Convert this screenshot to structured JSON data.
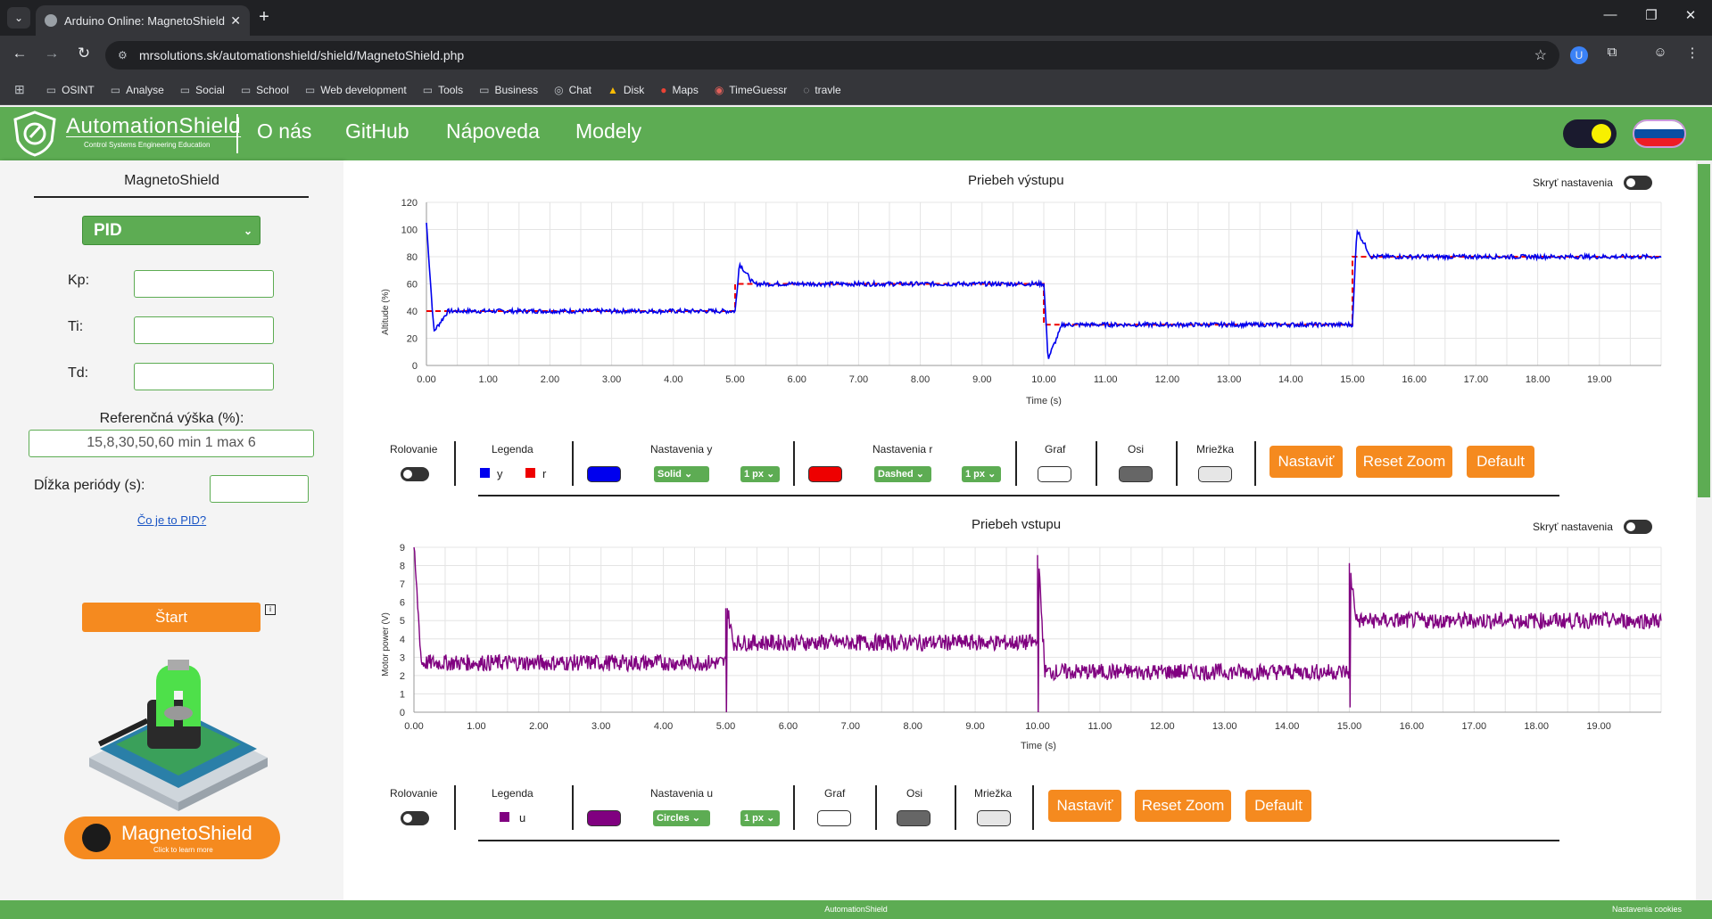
{
  "browser": {
    "tab_title": "Arduino Online: MagnetoShield",
    "url": "mrsolutions.sk/automationshield/shield/MagnetoShield.php",
    "bookmarks": [
      "OSINT",
      "Analyse",
      "Social",
      "School",
      "Web development",
      "Tools",
      "Business",
      "Chat",
      "Disk",
      "Maps",
      "TimeGuessr",
      "travle"
    ]
  },
  "header": {
    "logo_title": "AutomationShield",
    "logo_sub": "Control Systems Engineering Education",
    "nav": [
      "O nás",
      "GitHub",
      "Nápoveda",
      "Modely"
    ]
  },
  "sidebar": {
    "title": "MagnetoShield",
    "mode": "PID",
    "kp_label": "Kp:",
    "ti_label": "Ti:",
    "td_label": "Td:",
    "ref_label": "Referenčná výška (%):",
    "ref_placeholder": "15,8,30,50,60 min 1 max 6",
    "period_label": "Dĺžka periódy (s):",
    "pid_link": "Čo je to PID?",
    "start": "Štart",
    "gh_text": "MagnetoShield",
    "gh_sub": "Click to learn more"
  },
  "chart1": {
    "title": "Priebeh výstupu",
    "hide_label": "Skryť nastavenia",
    "ylabel": "Altitude (%)",
    "xlabel": "Time (s)",
    "controls": {
      "rolovanie": "Rolovanie",
      "legenda": "Legenda",
      "legend_y": "y",
      "legend_r": "r",
      "nast_y": "Nastavenia y",
      "nast_r": "Nastavenia r",
      "y_style": "Solid",
      "y_width": "1 px",
      "r_style": "Dashed",
      "r_width": "1 px",
      "graf": "Graf",
      "osi": "Osi",
      "mriezka": "Mriežka",
      "nastavit": "Nastaviť",
      "reset_zoom": "Reset Zoom",
      "default": "Default"
    }
  },
  "chart2": {
    "title": "Priebeh vstupu",
    "hide_label": "Skryť nastavenia",
    "ylabel": "Motor power (V)",
    "xlabel": "Time (s)",
    "controls": {
      "rolovanie": "Rolovanie",
      "legenda": "Legenda",
      "legend_u": "u",
      "nast_u": "Nastavenia u",
      "u_style": "Circles",
      "u_width": "1 px",
      "graf": "Graf",
      "osi": "Osi",
      "mriezka": "Mriežka",
      "nastavit": "Nastaviť",
      "reset_zoom": "Reset Zoom",
      "default": "Default"
    }
  },
  "footer": {
    "center": "AutomationShield",
    "right": "Nastavenia cookies"
  },
  "colors": {
    "green": "#5dac53",
    "orange": "#f58a1f",
    "y_series": "#0000ee",
    "r_series": "#ee0000",
    "u_series": "#800080"
  },
  "chart_data": [
    {
      "type": "line",
      "title": "Priebeh výstupu",
      "xlabel": "Time (s)",
      "ylabel": "Altitude (%)",
      "xlim": [
        0,
        20
      ],
      "ylim": [
        0,
        120
      ],
      "x_ticks": [
        "0.00",
        "1.00",
        "2.00",
        "3.00",
        "4.00",
        "5.00",
        "6.00",
        "7.00",
        "8.00",
        "9.00",
        "10.00",
        "11.00",
        "12.00",
        "13.00",
        "14.00",
        "15.00",
        "16.00",
        "17.00",
        "18.00",
        "19.00"
      ],
      "y_ticks": [
        0,
        20,
        40,
        60,
        80,
        100,
        120
      ],
      "grid": true,
      "series": [
        {
          "name": "y",
          "color": "#0000ee",
          "style": "solid",
          "segments": [
            {
              "t0": 0,
              "t1": 5,
              "level": 40,
              "start": 105,
              "dip": 25
            },
            {
              "t0": 5,
              "t1": 10,
              "level": 60,
              "overshoot": 75
            },
            {
              "t0": 10,
              "t1": 15,
              "level": 30,
              "undershoot": 5
            },
            {
              "t0": 15,
              "t1": 20,
              "level": 80,
              "overshoot": 100
            }
          ]
        },
        {
          "name": "r",
          "color": "#ee0000",
          "style": "dashed",
          "steps": [
            {
              "t0": 0,
              "t1": 5,
              "v": 40
            },
            {
              "t0": 5,
              "t1": 10,
              "v": 60
            },
            {
              "t0": 10,
              "t1": 15,
              "v": 30
            },
            {
              "t0": 15,
              "t1": 20,
              "v": 80
            }
          ]
        }
      ]
    },
    {
      "type": "line",
      "title": "Priebeh vstupu",
      "xlabel": "Time (s)",
      "ylabel": "Motor power (V)",
      "xlim": [
        0,
        20
      ],
      "ylim": [
        0,
        9
      ],
      "x_ticks": [
        "0.00",
        "1.00",
        "2.00",
        "3.00",
        "4.00",
        "5.00",
        "6.00",
        "7.00",
        "8.00",
        "9.00",
        "10.00",
        "11.00",
        "12.00",
        "13.00",
        "14.00",
        "15.00",
        "16.00",
        "17.00",
        "18.00",
        "19.00"
      ],
      "y_ticks": [
        0,
        1,
        2,
        3,
        4,
        5,
        6,
        7,
        8,
        9
      ],
      "grid": true,
      "series": [
        {
          "name": "u",
          "color": "#800080",
          "segments": [
            {
              "t0": 0,
              "t1": 5,
              "level": 2.7,
              "spike": 9
            },
            {
              "t0": 5,
              "t1": 10,
              "level": 3.8,
              "spike": 6.1
            },
            {
              "t0": 10,
              "t1": 15,
              "level": 2.2,
              "spike": 9
            },
            {
              "t0": 15,
              "t1": 20,
              "level": 5.0,
              "spike": 8
            }
          ]
        }
      ]
    }
  ]
}
